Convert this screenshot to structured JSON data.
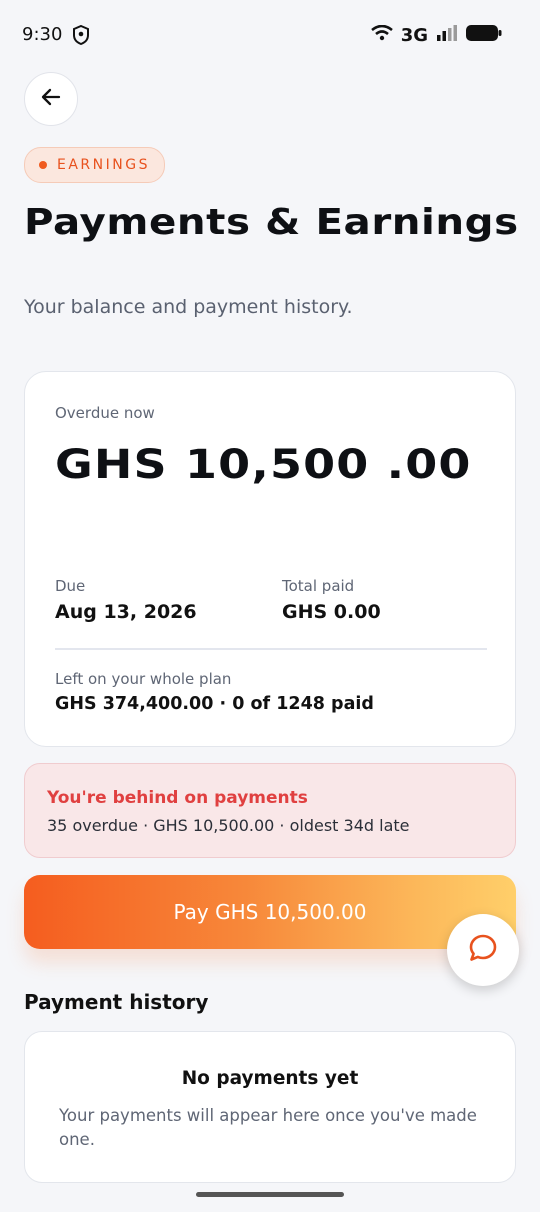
{
  "status_bar": {
    "time": "9:30",
    "network": "3G"
  },
  "pill": {
    "label": "EARNINGS"
  },
  "page": {
    "title": "Payments & Earnings",
    "subtitle": "Your balance and payment history."
  },
  "summary": {
    "overdue_label": "Overdue now",
    "overdue_amount": "GHS 10,500 .00",
    "due_label": "Due",
    "due_value": "Aug 13, 2026",
    "total_paid_label": "Total paid",
    "total_paid_value": "GHS 0.00",
    "left_label": "Left on your whole plan",
    "left_value": "GHS 374,400.00  ·  0 of 1248 paid"
  },
  "alert": {
    "title": "You're behind on payments",
    "text": "35 overdue · GHS 10,500.00 · oldest 34d late"
  },
  "pay_button": {
    "label": "Pay GHS 10,500.00"
  },
  "history": {
    "title": "Payment history",
    "empty_title": "No payments yet",
    "empty_text": "Your payments will appear here once you've made one."
  },
  "colors": {
    "accent": "#f05a1e",
    "alert_text": "#e04040",
    "background": "#f5f6f9"
  },
  "icons": {
    "back": "arrow-left-icon",
    "chat": "chat-bubble-icon",
    "shield": "shield-icon",
    "wifi": "wifi-icon",
    "signal": "signal-icon",
    "battery": "battery-icon"
  }
}
